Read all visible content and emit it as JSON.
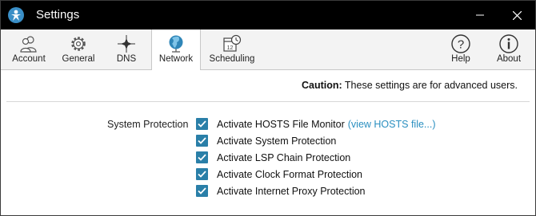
{
  "window": {
    "title": "Settings"
  },
  "toolbar": {
    "tabs": [
      {
        "label": "Account",
        "icon": "users-icon"
      },
      {
        "label": "General",
        "icon": "gear-icon"
      },
      {
        "label": "DNS",
        "icon": "crosshair-icon"
      },
      {
        "label": "Network",
        "icon": "globe-icon",
        "active": true
      },
      {
        "label": "Scheduling",
        "icon": "calendar-clock-icon"
      }
    ],
    "help_label": "Help",
    "about_label": "About"
  },
  "caution": {
    "strong": "Caution:",
    "text": "These settings are for advanced users."
  },
  "system_protection": {
    "label": "System Protection",
    "options": [
      {
        "label": "Activate HOSTS File Monitor",
        "checked": true,
        "link": "(view HOSTS file...)"
      },
      {
        "label": "Activate System Protection",
        "checked": true
      },
      {
        "label": "Activate LSP Chain Protection",
        "checked": true
      },
      {
        "label": "Activate Clock Format Protection",
        "checked": true
      },
      {
        "label": "Activate Internet Proxy Protection",
        "checked": true
      }
    ]
  },
  "colors": {
    "accent": "#2a7fa8",
    "link": "#2a8fc0",
    "titlebar": "#000000"
  }
}
